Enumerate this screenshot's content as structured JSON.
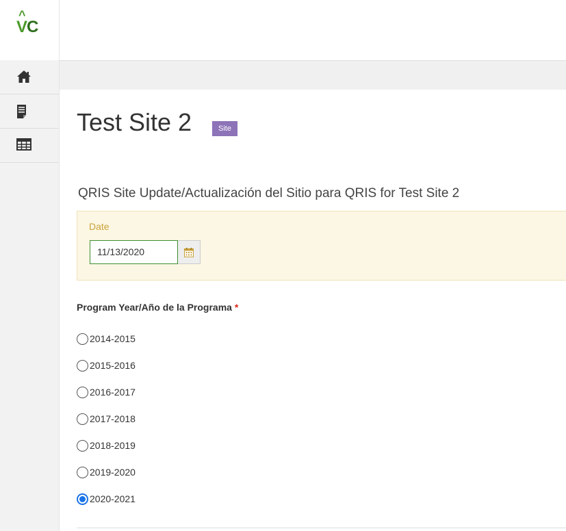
{
  "logo": {
    "text_v": "V",
    "text_c": "C",
    "hat": "^"
  },
  "page": {
    "title": "Test Site 2",
    "badge": "Site"
  },
  "form": {
    "title": "QRIS Site Update/Actualización del Sitio para QRIS for Test Site 2",
    "date_label": "Date",
    "date_value": "11/13/2020",
    "question_label": "Program Year/Año de la Programa",
    "required_mark": "*",
    "options": [
      {
        "label": "2014-2015",
        "checked": false
      },
      {
        "label": "2015-2016",
        "checked": false
      },
      {
        "label": "2016-2017",
        "checked": false
      },
      {
        "label": "2017-2018",
        "checked": false
      },
      {
        "label": "2018-2019",
        "checked": false
      },
      {
        "label": "2019-2020",
        "checked": false
      },
      {
        "label": "2020-2021",
        "checked": true
      }
    ]
  },
  "nav": {
    "items": [
      "home-icon",
      "document-icon",
      "table-icon"
    ]
  },
  "colors": {
    "badge": "#8d73b7",
    "date_panel": "#fcf7e4",
    "date_label": "#c9a13b",
    "radio_checked": "#1a73e8",
    "logo_green": "#4d9a2b"
  }
}
